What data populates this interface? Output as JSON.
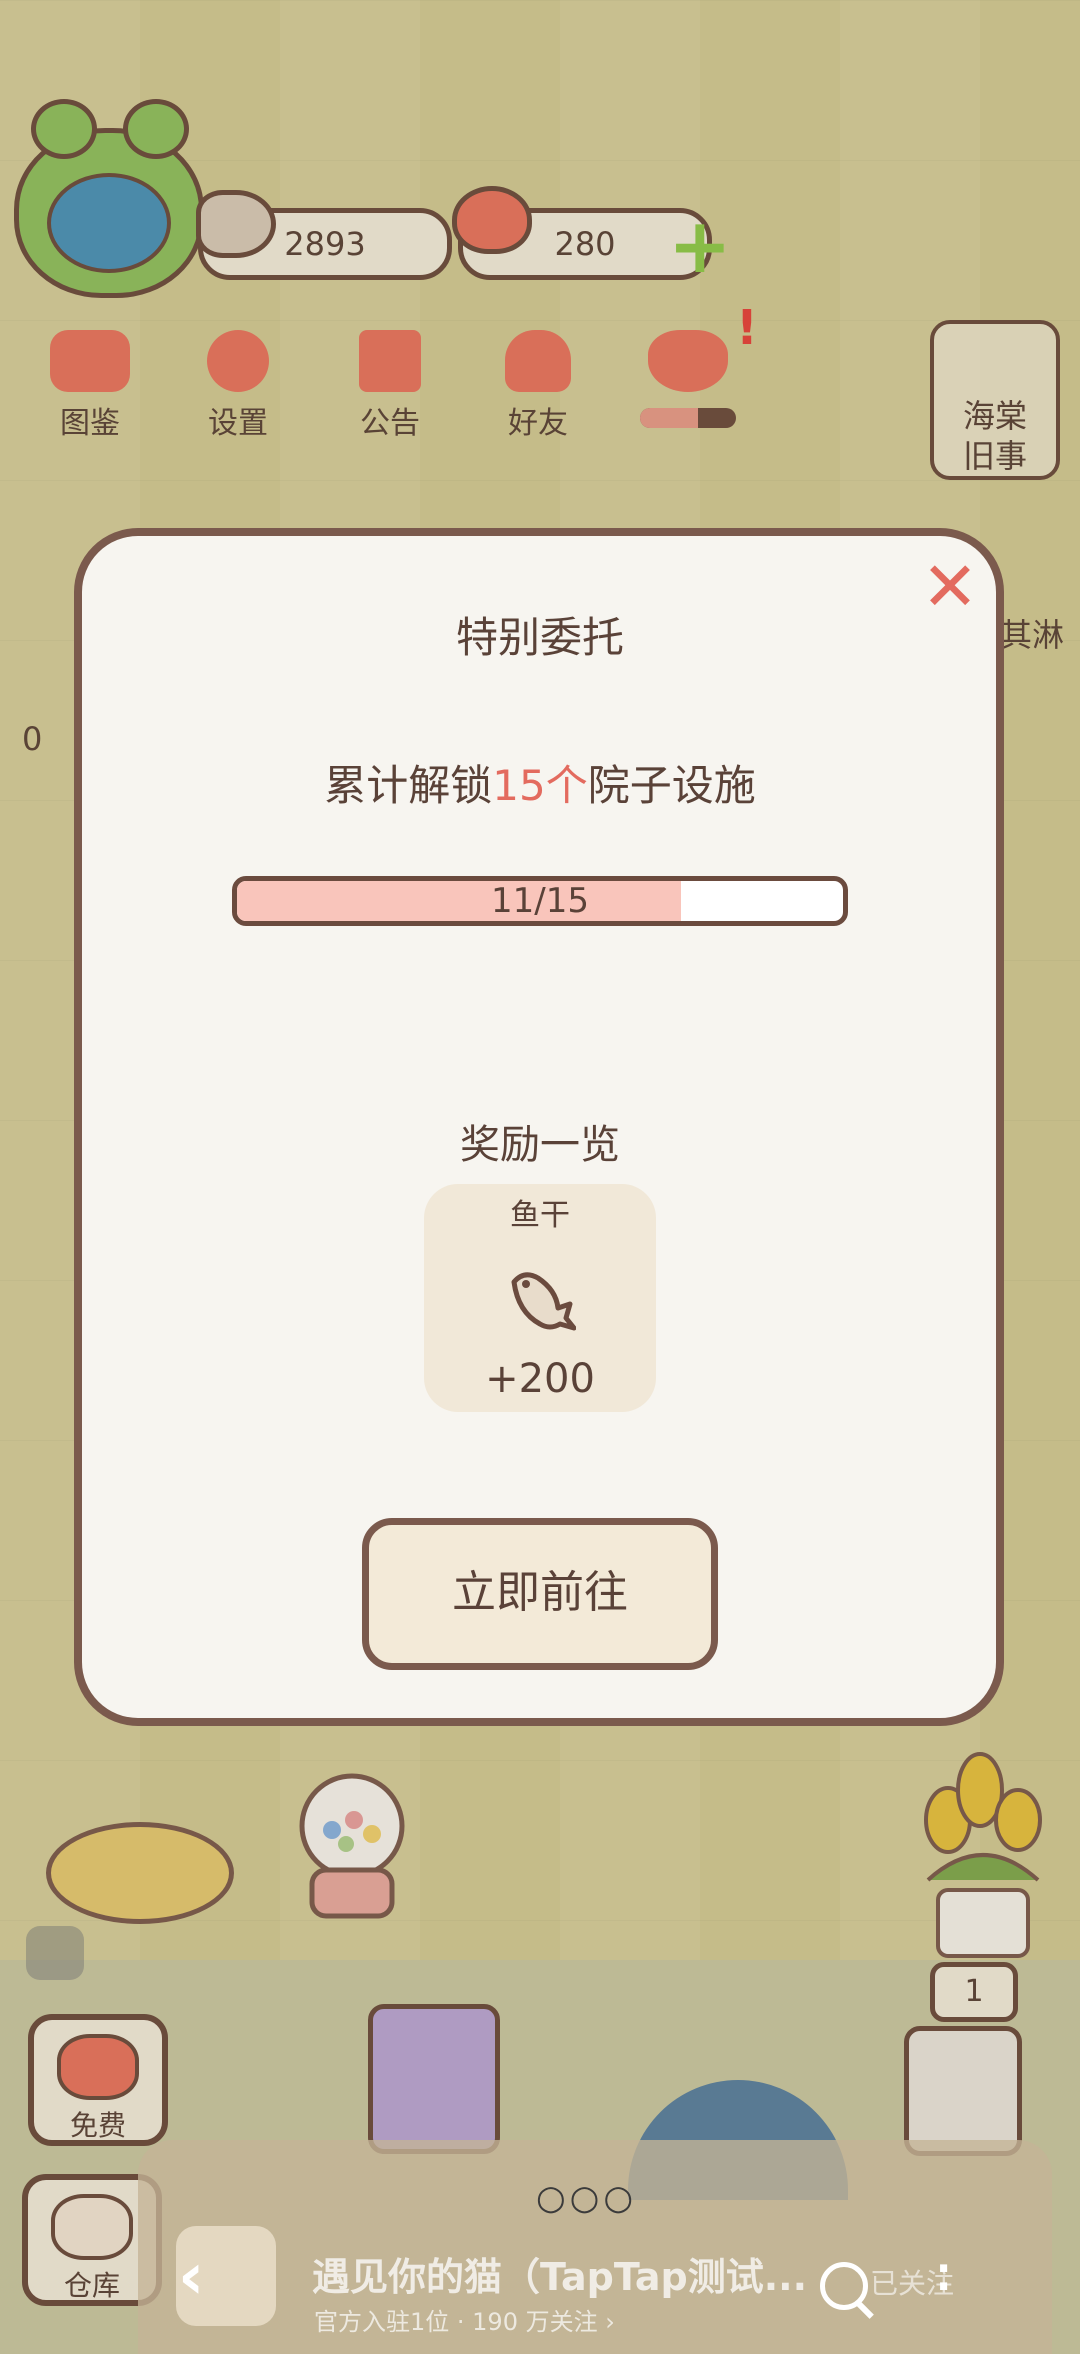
{
  "hud": {
    "fish_count": "2893",
    "heart_count": "280",
    "top_buttons": [
      {
        "label": "图鉴",
        "icon": "cat-face-icon"
      },
      {
        "label": "设置",
        "icon": "gear-icon"
      },
      {
        "label": "公告",
        "icon": "gift-icon"
      },
      {
        "label": "好友",
        "icon": "friends-icon"
      },
      {
        "label": "",
        "icon": "hearts-icon"
      }
    ],
    "side_card_line1": "海棠",
    "side_card_line2": "旧事",
    "side_fragment": "其淋",
    "left_fragment": "0"
  },
  "modal": {
    "title": "特别委托",
    "goal_prefix": "累计解锁",
    "goal_highlight": "15个",
    "goal_suffix": "院子设施",
    "progress_text": "11/15",
    "progress_fraction": 0.733,
    "rewards_title": "奖励一览",
    "reward": {
      "name": "鱼干",
      "amount": "+200",
      "icon": "dried-fish-icon"
    },
    "go_button": "立即前往",
    "close_icon": "close-icon"
  },
  "scene": {
    "free_label": "免费",
    "store_label": "仓库",
    "counter_badge": "1"
  },
  "app_overlay": {
    "dots": "○○○",
    "title": "遇见你的猫（TapTap测试...",
    "subtitle": "官方入驻1位 · 190 万关注 ›",
    "follow_label": "已关注"
  },
  "colors": {
    "accent_red": "#e36b5f",
    "progress_fill": "#f9c5bb",
    "outline_brown": "#6b4b3e",
    "modal_bg": "#f7f5f0"
  }
}
